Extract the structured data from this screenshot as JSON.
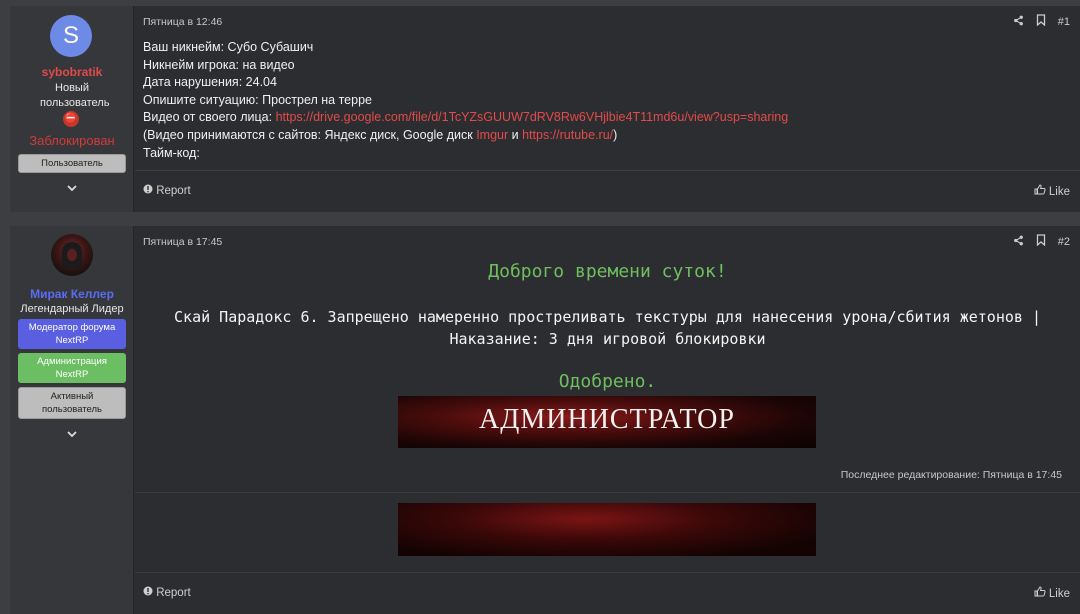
{
  "posts": [
    {
      "user": {
        "avatar_letter": "S",
        "avatar_color": "#6d8ae6",
        "name": "sybobratik",
        "name_color": "#e14a4a",
        "title": "Новый пользователь",
        "status": "Заблокирован",
        "badges": [
          {
            "label": "Пользователь",
            "bg": "#bdbdbd",
            "color": "#222222"
          }
        ]
      },
      "date": "Пятница в 12:46",
      "number": "#1",
      "lines": [
        {
          "label": "Ваш никнейм:",
          "value": "Субо Субашич"
        },
        {
          "label": "Никнейм игрока:",
          "value": "на видео"
        },
        {
          "label": "Дата нарушения:",
          "value": "24.04"
        },
        {
          "label": "Опишите ситуацию:",
          "value": "Прострел на терре"
        },
        {
          "label": "Видео от своего лица:",
          "link": "https://drive.google.com/file/d/1TcYZsGUUW7dRV8Rw6VHjlbie4T11md6u/view?usp=sharing"
        }
      ],
      "sites_prefix": "(Видео принимаются с сайтов: Яндекс диск, Google диск",
      "sites_link1": "Imgur",
      "sites_and": "и",
      "sites_link2": "https://rutube.ru/",
      "sites_suffix": ")",
      "timecode": "Тайм-код:",
      "report": "Report",
      "like": "Like"
    },
    {
      "user": {
        "name": "Мирак Келлер",
        "name_color": "#5b6cf0",
        "title": "Легендарный Лидер",
        "badges": [
          {
            "label": "Модератор форума NextRP",
            "bg": "#5a5ee0",
            "color": "#ffffff"
          },
          {
            "label": "Администрация NextRP",
            "bg": "#6bbf62",
            "color": "#ffffff"
          },
          {
            "label": "Активный пользователь",
            "bg": "#bdbdbd",
            "color": "#222222"
          }
        ]
      },
      "date": "Пятница в 17:45",
      "number": "#2",
      "greeting": "Доброго времени суток!",
      "rule_text": "Скай Парадокс 6. Запрещено намеренно простреливать текстуры для нанесения урона/сбития жетонов | Наказание: 3 дня игровой блокировки",
      "verdict": "Одобрено.",
      "banner_text": "АДМИНИСТРАТОР",
      "edited": "Последнее редактирование: Пятница в 17:45",
      "report": "Report",
      "like": "Like"
    }
  ],
  "colors": {
    "link": "#e34a4a",
    "green_text": "#6fbf5f",
    "banned": "#d33a3a"
  }
}
